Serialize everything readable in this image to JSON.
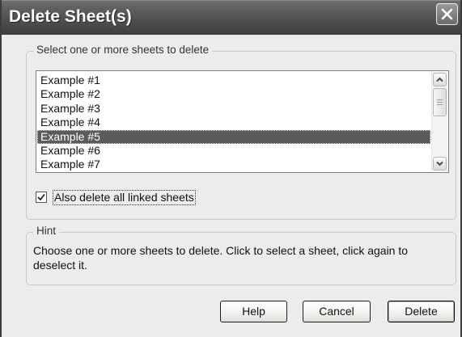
{
  "dialog": {
    "title": "Delete Sheet(s)",
    "close_icon": "close-icon"
  },
  "sheets_group": {
    "legend": "Select one or more sheets to delete",
    "items": [
      {
        "label": "Example #1",
        "selected": false
      },
      {
        "label": "Example #2",
        "selected": false
      },
      {
        "label": "Example #3",
        "selected": false
      },
      {
        "label": "Example #4",
        "selected": false
      },
      {
        "label": "Example #5",
        "selected": true
      },
      {
        "label": "Example #6",
        "selected": false
      },
      {
        "label": "Example #7",
        "selected": false
      }
    ],
    "also_delete_linked": {
      "label": "Also delete all linked sheets",
      "checked": true
    }
  },
  "hint_group": {
    "legend": "Hint",
    "text": "Choose one or more sheets to delete. Click to select a sheet, click again to deselect it."
  },
  "buttons": {
    "help": "Help",
    "cancel": "Cancel",
    "delete": "Delete"
  },
  "colors": {
    "selection_bg": "#5b5b5b",
    "titlebar": "#555555",
    "dialog_bg": "#ececea"
  }
}
